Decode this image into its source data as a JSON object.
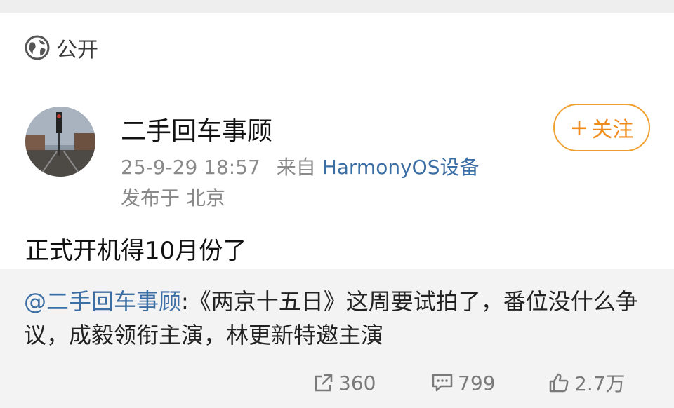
{
  "visibility": {
    "icon": "globe-icon",
    "label": "公开"
  },
  "author": {
    "name": "二手回车事顾",
    "avatar": "avatar-photo"
  },
  "post_meta": {
    "timestamp": "25-9-29 18:57",
    "source_prefix": "来自",
    "device": "HarmonyOS设备",
    "location": "发布于 北京"
  },
  "follow_button": {
    "plus": "+",
    "label": "关注",
    "color": "#f08a1a"
  },
  "post": {
    "text": "正式开机得10月份了"
  },
  "repost": {
    "mention": "@二手回车事顾",
    "body": ":《两京十五日》这周要试拍了，番位没什么争议，成毅领衔主演，林更新特邀主演"
  },
  "stats": {
    "repost_icon": "share-icon",
    "reposts": "360",
    "comment_icon": "comment-icon",
    "comments": "799",
    "like_icon": "thumbs-up-icon",
    "likes": "2.7万"
  },
  "colors": {
    "link": "#3b6ea5",
    "accent": "#f08a1a",
    "repost_bg": "#f3f3f3"
  }
}
